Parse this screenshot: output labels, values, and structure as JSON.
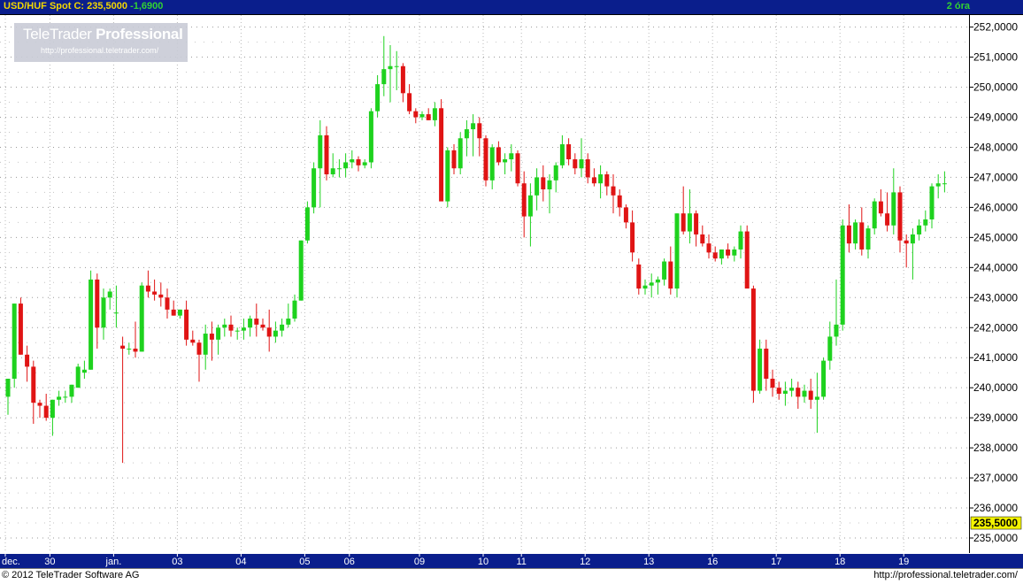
{
  "header": {
    "symbol": "USD/HUF Spot",
    "close_label": "C: 235,5000",
    "change": "-1,6900",
    "interval": "2 óra"
  },
  "watermark": {
    "brand_plain": "TeleTrader ",
    "brand_bold": "Professional",
    "url": "http://professional.teletrader.com/"
  },
  "footer": {
    "copyright": "© 2012 TeleTrader Software AG",
    "url": "http://professional.teletrader.com/"
  },
  "colors": {
    "up": "#1ed21e",
    "down": "#e01414",
    "axis_bg": "#0a1e8c",
    "last_price_bg": "#f3f300"
  },
  "chart_data": {
    "type": "candlestick",
    "ylim": [
      234.5,
      252.4
    ],
    "y_ticks": [
      {
        "value": 235,
        "label": "235,0000"
      },
      {
        "value": 236,
        "label": "236,0000"
      },
      {
        "value": 237,
        "label": "237,0000"
      },
      {
        "value": 238,
        "label": "238,0000"
      },
      {
        "value": 239,
        "label": "239,0000"
      },
      {
        "value": 240,
        "label": "240,0000"
      },
      {
        "value": 241,
        "label": "241,0000"
      },
      {
        "value": 242,
        "label": "242,0000"
      },
      {
        "value": 243,
        "label": "243,0000"
      },
      {
        "value": 244,
        "label": "244,0000"
      },
      {
        "value": 245,
        "label": "245,0000"
      },
      {
        "value": 246,
        "label": "246,0000"
      },
      {
        "value": 247,
        "label": "247,0000"
      },
      {
        "value": 248,
        "label": "248,0000"
      },
      {
        "value": 249,
        "label": "249,0000"
      },
      {
        "value": 250,
        "label": "250,0000"
      },
      {
        "value": 251,
        "label": "251,0000"
      },
      {
        "value": 252,
        "label": "252,0000"
      }
    ],
    "last_price": {
      "value": 235.5,
      "label": "235,5000"
    },
    "x_labels": [
      {
        "index": 0,
        "label": "dec."
      },
      {
        "index": 7,
        "label": "30"
      },
      {
        "index": 17,
        "label": "jan."
      },
      {
        "index": 27,
        "label": "03"
      },
      {
        "index": 37,
        "label": "04"
      },
      {
        "index": 47,
        "label": "05"
      },
      {
        "index": 54,
        "label": "06"
      },
      {
        "index": 65,
        "label": "09"
      },
      {
        "index": 75,
        "label": "10"
      },
      {
        "index": 81,
        "label": "11"
      },
      {
        "index": 91,
        "label": "12"
      },
      {
        "index": 101,
        "label": "13"
      },
      {
        "index": 111,
        "label": "16"
      },
      {
        "index": 121,
        "label": "17"
      },
      {
        "index": 131,
        "label": "18"
      },
      {
        "index": 141,
        "label": "19"
      }
    ],
    "ohlc": [
      [
        239.7,
        240.3,
        239.1,
        240.3
      ],
      [
        240.3,
        242.8,
        240.0,
        242.8
      ],
      [
        242.8,
        243.0,
        241.1,
        241.1
      ],
      [
        241.1,
        241.4,
        240.2,
        240.7
      ],
      [
        240.7,
        240.9,
        238.8,
        239.5
      ],
      [
        239.5,
        239.6,
        239.0,
        239.4
      ],
      [
        239.4,
        239.8,
        238.9,
        239.0
      ],
      [
        239.0,
        239.6,
        238.4,
        239.6
      ],
      [
        239.6,
        239.9,
        239.4,
        239.7
      ],
      [
        239.7,
        239.9,
        239.5,
        239.7
      ],
      [
        239.7,
        240.1,
        239.5,
        240.1
      ],
      [
        240.0,
        240.8,
        240.0,
        240.7
      ],
      [
        240.5,
        240.9,
        240.3,
        240.6
      ],
      [
        240.6,
        243.9,
        240.6,
        243.6
      ],
      [
        243.6,
        243.8,
        241.3,
        242.0
      ],
      [
        242.0,
        243.3,
        241.6,
        243.0
      ],
      [
        243.0,
        243.3,
        242.6,
        243.2
      ],
      [
        242.5,
        243.4,
        242.0,
        242.5
      ],
      [
        241.4,
        241.7,
        237.5,
        241.3
      ],
      [
        241.3,
        241.5,
        241.1,
        241.3
      ],
      [
        241.3,
        242.2,
        241.0,
        241.2
      ],
      [
        241.2,
        243.5,
        241.2,
        243.4
      ],
      [
        243.4,
        243.9,
        243.0,
        243.2
      ],
      [
        243.2,
        243.6,
        242.9,
        243.1
      ],
      [
        243.1,
        243.5,
        242.7,
        243.0
      ],
      [
        243.0,
        243.3,
        242.3,
        242.6
      ],
      [
        242.6,
        242.9,
        242.4,
        242.4
      ],
      [
        242.4,
        242.6,
        242.3,
        242.6
      ],
      [
        242.6,
        242.9,
        241.4,
        241.6
      ],
      [
        241.6,
        241.9,
        241.4,
        241.5
      ],
      [
        241.5,
        241.6,
        240.2,
        241.1
      ],
      [
        241.1,
        242.1,
        240.6,
        241.8
      ],
      [
        241.8,
        242.2,
        240.9,
        241.6
      ],
      [
        241.6,
        242.1,
        241.1,
        242.0
      ],
      [
        242.0,
        242.3,
        241.7,
        242.1
      ],
      [
        242.1,
        242.4,
        241.7,
        241.9
      ],
      [
        241.9,
        242.0,
        241.6,
        241.9
      ],
      [
        241.9,
        242.3,
        241.6,
        242.0
      ],
      [
        242.0,
        242.4,
        241.7,
        242.3
      ],
      [
        242.3,
        242.8,
        241.7,
        242.1
      ],
      [
        242.1,
        242.3,
        241.9,
        242.0
      ],
      [
        242.0,
        242.6,
        241.2,
        241.7
      ],
      [
        241.7,
        242.2,
        241.5,
        241.9
      ],
      [
        241.9,
        242.3,
        241.7,
        242.1
      ],
      [
        242.1,
        242.8,
        242.0,
        242.3
      ],
      [
        242.3,
        243.1,
        242.2,
        242.9
      ],
      [
        242.9,
        244.9,
        242.9,
        244.9
      ],
      [
        244.9,
        246.2,
        244.8,
        246.0
      ],
      [
        246.0,
        247.5,
        245.8,
        247.3
      ],
      [
        247.3,
        248.9,
        246.0,
        248.4
      ],
      [
        248.4,
        248.7,
        246.9,
        247.1
      ],
      [
        247.1,
        247.8,
        247.0,
        247.3
      ],
      [
        247.3,
        247.6,
        247.0,
        247.3
      ],
      [
        247.3,
        247.8,
        247.0,
        247.5
      ],
      [
        247.5,
        247.9,
        247.3,
        247.6
      ],
      [
        247.6,
        247.7,
        247.2,
        247.4
      ],
      [
        247.4,
        247.6,
        247.3,
        247.5
      ],
      [
        247.5,
        249.3,
        247.3,
        249.2
      ],
      [
        249.2,
        250.4,
        249.0,
        250.1
      ],
      [
        250.1,
        251.7,
        249.7,
        250.6
      ],
      [
        250.6,
        251.4,
        249.5,
        250.7
      ],
      [
        250.7,
        251.2,
        249.9,
        250.7
      ],
      [
        250.7,
        250.8,
        249.5,
        249.8
      ],
      [
        249.8,
        250.1,
        249.1,
        249.2
      ],
      [
        249.2,
        249.3,
        248.8,
        249.0
      ],
      [
        249.0,
        249.2,
        248.9,
        249.1
      ],
      [
        249.1,
        249.3,
        248.9,
        248.9
      ],
      [
        248.9,
        249.5,
        248.7,
        249.3
      ],
      [
        249.3,
        249.6,
        246.3,
        246.2
      ],
      [
        246.2,
        248.0,
        246.0,
        247.9
      ],
      [
        247.9,
        248.1,
        247.1,
        247.3
      ],
      [
        247.3,
        248.5,
        247.1,
        248.3
      ],
      [
        248.3,
        248.9,
        247.7,
        248.6
      ],
      [
        248.6,
        249.1,
        247.7,
        248.8
      ],
      [
        248.8,
        249.0,
        247.7,
        248.3
      ],
      [
        248.3,
        248.4,
        246.7,
        246.9
      ],
      [
        246.9,
        248.1,
        246.6,
        248.0
      ],
      [
        248.0,
        248.2,
        247.4,
        247.5
      ],
      [
        247.5,
        247.8,
        247.1,
        247.6
      ],
      [
        247.6,
        248.1,
        247.2,
        247.8
      ],
      [
        247.8,
        247.9,
        246.7,
        246.8
      ],
      [
        246.8,
        247.2,
        245.0,
        245.7
      ],
      [
        245.7,
        246.8,
        244.7,
        246.4
      ],
      [
        246.4,
        247.3,
        245.9,
        247.0
      ],
      [
        247.0,
        247.4,
        246.2,
        246.6
      ],
      [
        246.6,
        247.1,
        245.8,
        246.9
      ],
      [
        246.9,
        247.5,
        246.5,
        247.4
      ],
      [
        247.4,
        248.4,
        247.3,
        248.1
      ],
      [
        248.1,
        248.3,
        247.4,
        247.6
      ],
      [
        247.6,
        247.8,
        247.1,
        247.3
      ],
      [
        247.3,
        248.3,
        247.0,
        247.6
      ],
      [
        247.6,
        247.8,
        246.8,
        247.0
      ],
      [
        247.0,
        247.3,
        246.7,
        246.8
      ],
      [
        246.8,
        247.4,
        246.3,
        247.1
      ],
      [
        247.1,
        247.2,
        246.4,
        246.7
      ],
      [
        246.7,
        247.1,
        245.8,
        246.4
      ],
      [
        246.4,
        246.6,
        245.7,
        246.0
      ],
      [
        246.0,
        246.1,
        245.3,
        245.5
      ],
      [
        245.5,
        245.9,
        244.2,
        244.5
      ],
      [
        244.1,
        244.3,
        243.1,
        243.3
      ],
      [
        243.3,
        243.6,
        243.1,
        243.4
      ],
      [
        243.4,
        243.8,
        243.0,
        243.5
      ],
      [
        243.5,
        243.7,
        243.1,
        243.6
      ],
      [
        243.6,
        244.3,
        243.4,
        244.2
      ],
      [
        244.2,
        244.7,
        243.1,
        243.3
      ],
      [
        243.3,
        245.8,
        243.0,
        245.8
      ],
      [
        245.8,
        246.7,
        245.1,
        245.2
      ],
      [
        245.2,
        246.6,
        244.8,
        245.8
      ],
      [
        245.8,
        245.9,
        244.7,
        245.1
      ],
      [
        245.1,
        245.4,
        244.7,
        244.8
      ],
      [
        244.8,
        245.1,
        244.3,
        244.5
      ],
      [
        244.5,
        244.7,
        244.2,
        244.3
      ],
      [
        244.3,
        244.6,
        244.1,
        244.6
      ],
      [
        244.6,
        244.8,
        244.3,
        244.4
      ],
      [
        244.4,
        244.7,
        244.2,
        244.6
      ],
      [
        244.6,
        245.4,
        244.3,
        245.2
      ],
      [
        245.2,
        245.4,
        243.7,
        243.3
      ],
      [
        243.3,
        243.4,
        239.5,
        239.9
      ],
      [
        239.9,
        241.6,
        239.8,
        241.3
      ],
      [
        241.3,
        241.6,
        239.9,
        240.3
      ],
      [
        240.3,
        240.6,
        239.7,
        240.0
      ],
      [
        240.0,
        240.2,
        239.6,
        239.8
      ],
      [
        239.8,
        240.2,
        239.4,
        239.9
      ],
      [
        239.9,
        240.3,
        239.7,
        240.0
      ],
      [
        240.0,
        240.2,
        239.3,
        239.7
      ],
      [
        239.7,
        240.1,
        239.5,
        239.9
      ],
      [
        239.9,
        240.3,
        239.3,
        239.6
      ],
      [
        239.6,
        240.5,
        238.5,
        239.7
      ],
      [
        239.7,
        241.0,
        239.6,
        240.9
      ],
      [
        240.9,
        242.2,
        240.6,
        241.7
      ],
      [
        241.7,
        243.6,
        241.4,
        242.1
      ],
      [
        242.1,
        245.6,
        241.9,
        245.4
      ],
      [
        245.4,
        246.1,
        244.5,
        244.8
      ],
      [
        244.8,
        245.6,
        244.6,
        245.5
      ],
      [
        245.5,
        246.0,
        244.4,
        244.6
      ],
      [
        244.6,
        245.4,
        244.3,
        245.3
      ],
      [
        245.3,
        246.3,
        245.1,
        246.2
      ],
      [
        246.2,
        246.6,
        245.7,
        245.8
      ],
      [
        245.8,
        246.5,
        245.2,
        245.4
      ],
      [
        245.4,
        247.3,
        245.1,
        246.5
      ],
      [
        246.5,
        246.7,
        244.5,
        244.9
      ],
      [
        244.9,
        245.1,
        244.0,
        244.8
      ],
      [
        244.8,
        245.3,
        243.6,
        245.1
      ],
      [
        245.1,
        245.6,
        244.9,
        245.4
      ],
      [
        245.4,
        245.9,
        245.2,
        245.6
      ],
      [
        245.6,
        246.8,
        245.3,
        246.7
      ],
      [
        246.7,
        247.1,
        246.3,
        246.8
      ],
      [
        246.8,
        247.2,
        246.5,
        246.8
      ]
    ]
  }
}
